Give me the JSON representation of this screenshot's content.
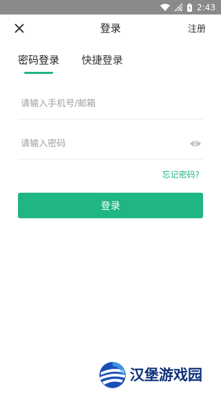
{
  "status_bar": {
    "time": "2:43"
  },
  "header": {
    "title": "登录",
    "register_label": "注册"
  },
  "tabs": [
    {
      "label": "密码登录",
      "active": true
    },
    {
      "label": "快捷登录",
      "active": false
    }
  ],
  "form": {
    "account_placeholder": "请输入手机号/邮箱",
    "password_placeholder": "请输入密码",
    "forgot_label": "忘记密码?",
    "submit_label": "登录"
  },
  "watermark": {
    "text": "汉堡游戏园"
  },
  "colors": {
    "accent": "#1fb585",
    "status_bar": "#8a8a8a",
    "watermark": "#0d2e7a"
  }
}
